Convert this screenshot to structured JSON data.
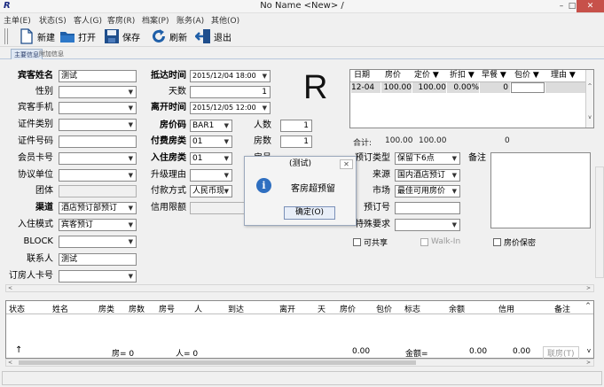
{
  "window": {
    "title": "No Name <New> /",
    "logo": "R",
    "minimize": "–",
    "maximize": "□",
    "close": "✕"
  },
  "menu": [
    "主单(E)",
    "状态(S)",
    "客人(G)",
    "客房(R)",
    "档案(P)",
    "账务(A)",
    "其他(O)"
  ],
  "toolbar": {
    "new": "新建",
    "open": "打开",
    "save": "保存",
    "refresh": "刷新",
    "exit": "退出"
  },
  "tabs": {
    "main": "主要信息",
    "extra": "附加信息"
  },
  "form": {
    "guest_name_label": "宾客姓名",
    "guest_name": "测试",
    "gender_label": "性别",
    "mobile_label": "宾客手机",
    "id_type_label": "证件类别",
    "id_number_label": "证件号码",
    "member_card_label": "会员卡号",
    "agreement_label": "协议单位",
    "group_label": "团体",
    "channel_label": "渠道",
    "channel": "酒店预订部预订",
    "checkin_mode_label": "入住模式",
    "checkin_mode": "宾客预订",
    "block_label": "BLOCK",
    "contact_label": "联系人",
    "contact": "测试",
    "booker_card_label": "订房人卡号",
    "arrival_label": "抵达时间",
    "arrival": "2015/12/04 18:00",
    "days_label": "天数",
    "days": "1",
    "departure_label": "离开时间",
    "departure": "2015/12/05 12:00",
    "rate_code_label": "房价码",
    "rate_code": "BAR1",
    "persons_label": "人数",
    "persons": "1",
    "paid_room_type_label": "付费房类",
    "paid_room_type": "01",
    "rooms_label": "房数",
    "rooms": "1",
    "checkin_room_type_label": "入住房类",
    "checkin_room_type": "01",
    "room_no_label": "房号",
    "upgrade_reason_label": "升级理由",
    "payment_label": "付款方式",
    "payment": "人民币现",
    "credit_limit_label": "信用限额",
    "reserve_type_label": "预订类型",
    "reserve_type": "保留下6点",
    "source_label": "来源",
    "source": "国内酒店预订",
    "market_label": "市场",
    "market": "最佳可用房价",
    "reserve_no_label": "预订号",
    "special_label": "特殊要求",
    "remark_label": "备注",
    "big_letter": "R"
  },
  "rate_grid": {
    "headers": [
      "日期",
      "房价",
      "定价 ▼",
      "折扣 ▼",
      "早餐 ▼",
      "包价 ▼",
      "理由 ▼"
    ],
    "row": [
      "12-04",
      "100.00",
      "100.00",
      "0.00%",
      "0"
    ],
    "sum_label": "合计:",
    "sum_rate": "100.00",
    "sum_price": "100.00",
    "sum_breakfast": "0"
  },
  "checkboxes": {
    "share": "可共享",
    "walkin": "Walk-In",
    "rate_keep": "房价保密"
  },
  "dialog": {
    "title": "(测试)",
    "message": "客房超预留",
    "ok": "确定(O)"
  },
  "bottom_table": {
    "headers": [
      "状态",
      "姓名",
      "房类",
      "房数",
      "房号",
      "人",
      "到达",
      "离开",
      "天",
      "房价",
      "包价",
      "标志",
      "余额",
      "信用",
      "备注"
    ],
    "footer": {
      "rooms": "房=  0",
      "persons": "人=  0",
      "rate_total": "0.00",
      "balance_label": "金额=",
      "balance": "0.00",
      "credit": "0.00",
      "link_room": "联房(T)"
    }
  }
}
